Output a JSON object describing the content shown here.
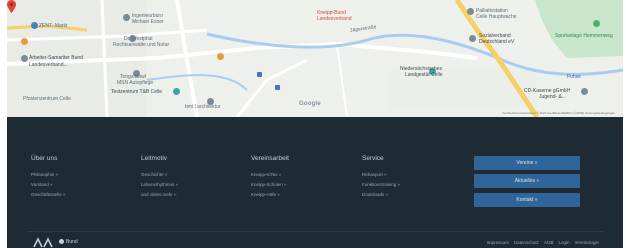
{
  "map": {
    "labels": {
      "zent_markt": "ZENT- Markt",
      "ingenieurburo": "Ingenieurbüro",
      "michael_exner": "Michael Exner",
      "dr_westphal": "Dr. Westphal",
      "rechtsanwalte": "Rechtsanwälte und Notar",
      "arbeiter_samariter": "Arbeiter-Samariter Bund",
      "landesverband": "Landesverband...",
      "marker_title": "Kneipp-Bund",
      "marker_sub": "Landesverband",
      "jagerstrasse": "Jägerstraße",
      "palliativ": "Palliativstation",
      "celle_hauptwache": "Celle Hauptwache",
      "sozialverband": "Sozialverband",
      "sozialverband_sub": "Deutschland eV",
      "sportanlage": "Sportanlage Hemmenweg",
      "tonga_bowl": "Tonga Bowl",
      "msn_autopflege": "MSN Autopflege",
      "testzentrum": "Testzentrum T&B Celle",
      "niedersachsisches": "Niedersächsisches",
      "landgestut": "Landgestüt Celle",
      "pfostenzentrum": "Pfostenzentrum Celle",
      "fuhse": "Fuhse",
      "cd_kaserne": "CD-Kaserne gGmbH",
      "cd_kaserne_sub": "Jugend- &...",
      "bmi_architektur": "bmi | architektur",
      "google": "Google",
      "attribution": "Kurzbefehle   Kartendaten © 2022 GeoBasis-DE/BKG (©2009)   Nutzungsbedingungen"
    }
  },
  "footer": {
    "columns": [
      {
        "heading": "Über uns",
        "links": [
          "Philosophie »",
          "Vorstand »",
          "Geschäftsstelle »"
        ]
      },
      {
        "heading": "Leitmotiv",
        "links": [
          "Geschichte »",
          "Lebensrhythmus »",
          "und vieles mehr »"
        ]
      },
      {
        "heading": "Vereinsarbeit",
        "links": [
          "Kneipp-KiTas »",
          "Kneipp-Schulen »",
          "Kneipp-Höfe »"
        ]
      },
      {
        "heading": "Service",
        "links": [
          "Rehasport »",
          "Funktionstraining »",
          "Downloads »"
        ]
      }
    ],
    "buttons": [
      "Vereine »",
      "Aktuelles »",
      "Kontakt »"
    ],
    "bund_text": "Bund",
    "legal_links": [
      "Impressum",
      "Datenschutz",
      "AGB",
      "Login",
      "Vereinslogin"
    ]
  }
}
